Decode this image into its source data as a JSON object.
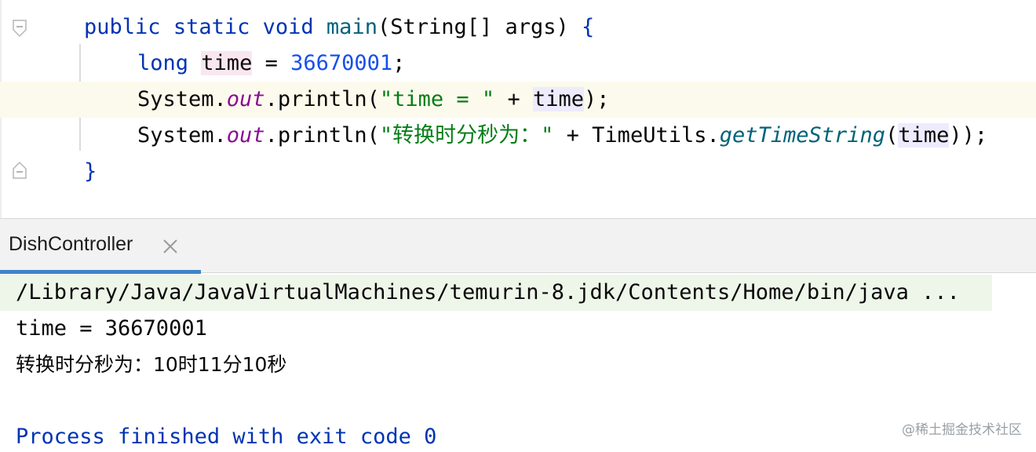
{
  "editor": {
    "lines": {
      "main_sig": {
        "public": "public",
        "static": "static",
        "void": "void",
        "name": "main",
        "params": "(String[] args) ",
        "brace": "{"
      },
      "decl": {
        "type": "long",
        "var": "time",
        "eq": " = ",
        "value": "36670001",
        "end": ";"
      },
      "println1": {
        "sys": "System.",
        "out": "out",
        "call": ".println(",
        "str": "\"time = \"",
        "plus": " + ",
        "var": "time",
        "end": ");"
      },
      "println2": {
        "sys": "System.",
        "out": "out",
        "call": ".println(",
        "str": "\"转换时分秒为：\"",
        "plus": " + TimeUtils.",
        "method": "getTimeString",
        "open": "(",
        "var": "time",
        "end": "));"
      },
      "close": {
        "brace": "}"
      }
    }
  },
  "run_panel": {
    "tab_label": "DishController",
    "console": {
      "command": "/Library/Java/JavaVirtualMachines/temurin-8.jdk/Contents/Home/bin/java ...",
      "output_1": "time = 36670001",
      "output_2": "转换时分秒为：10时11分10秒",
      "exit": "Process finished with exit code 0"
    }
  },
  "watermark": "@稀土掘金技术社区",
  "colors": {
    "keyword": "#0033b3",
    "number": "#1750eb",
    "string": "#067d17",
    "field": "#871094",
    "static_method": "#00627a",
    "current_line": "#fcfaed",
    "tab_underline": "#4083c9",
    "command_highlight": "#edf6e8"
  }
}
